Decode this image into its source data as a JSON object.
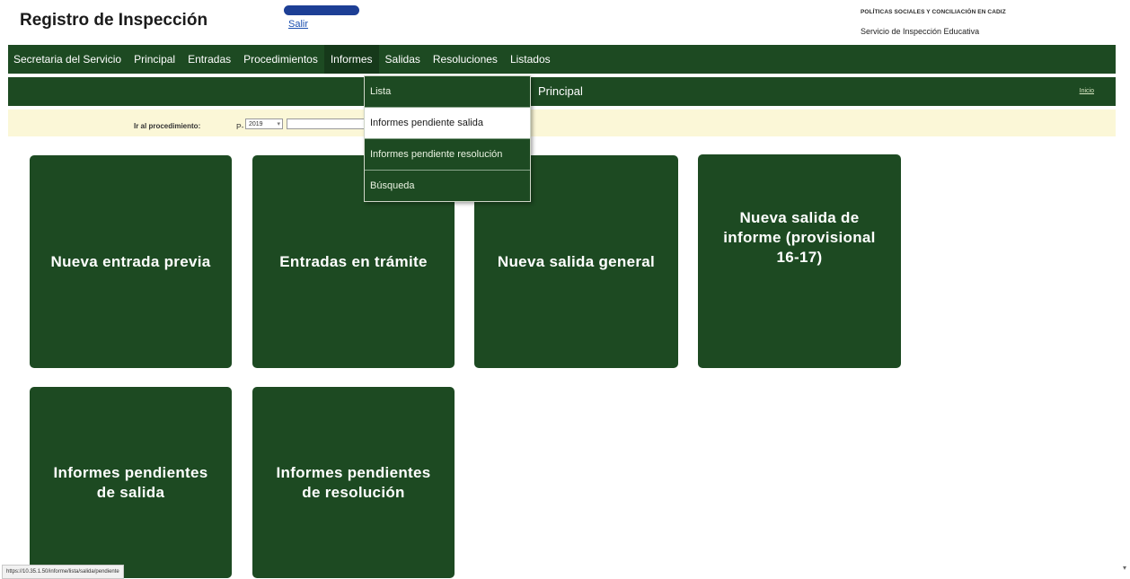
{
  "header": {
    "title": "Registro de Inspección",
    "logout": "Salir",
    "org_name": "POLÍTICAS SOCIALES Y CONCILIACIÓN EN CADIZ",
    "org_sub": "Servicio de Inspección Educativa"
  },
  "menu": [
    {
      "label": "Secretaria del Servicio"
    },
    {
      "label": "Principal"
    },
    {
      "label": "Entradas"
    },
    {
      "label": "Procedimientos"
    },
    {
      "label": "Informes"
    },
    {
      "label": "Salidas"
    },
    {
      "label": "Resoluciones"
    },
    {
      "label": "Listados"
    }
  ],
  "informes_dropdown": [
    {
      "label": "Lista"
    },
    {
      "label": "Informes pendiente salida"
    },
    {
      "label": "Informes pendiente resolución"
    },
    {
      "label": "Búsqueda"
    }
  ],
  "titlebar": {
    "page_title": "Principal",
    "home_link": "Inicio"
  },
  "goto": {
    "label": "Ir al procedimiento:",
    "prefix": "P-",
    "year": "2019"
  },
  "tiles": [
    {
      "label": "Nueva entrada previa"
    },
    {
      "label": "Entradas en trámite"
    },
    {
      "label": "Nueva salida general"
    },
    {
      "label": "Nueva salida de informe (provisional 16-17)"
    },
    {
      "label": "Informes pendientes de salida"
    },
    {
      "label": "Informes pendientes de resolución"
    }
  ],
  "status_url": "https://10.35.1.50/informe/lista/salida/pendiente",
  "colors": {
    "primary_green": "#1d4a22",
    "goto_bar": "#fbf7d7"
  }
}
